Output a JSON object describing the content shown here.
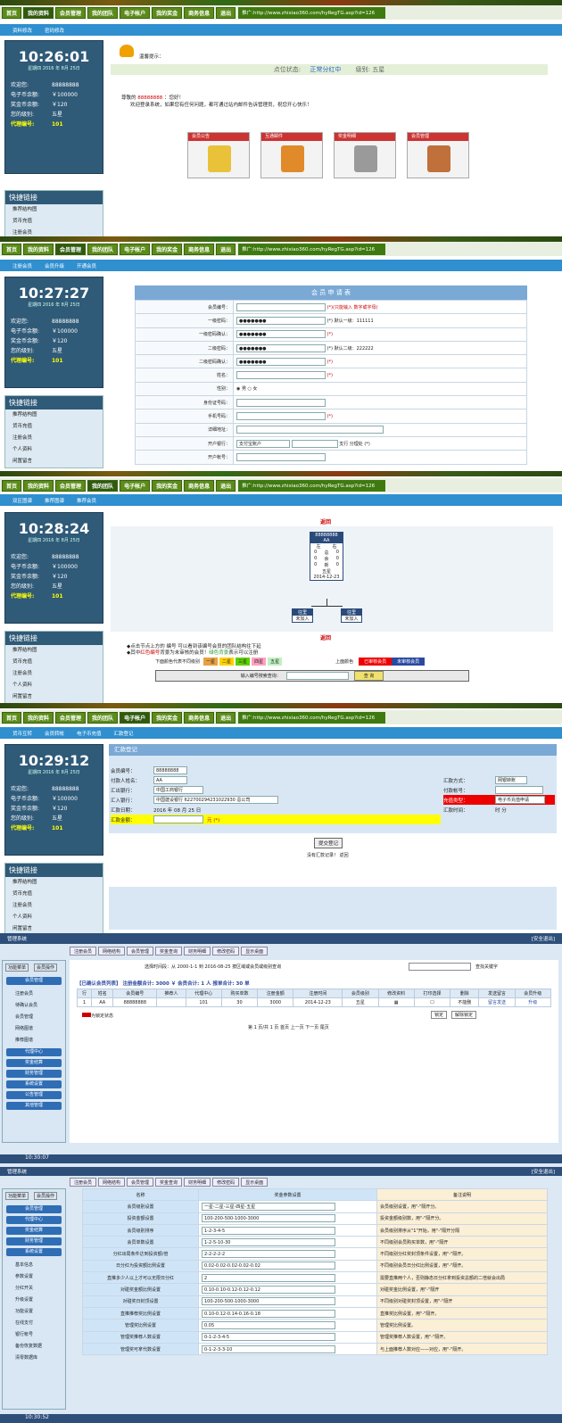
{
  "nav": {
    "items": [
      "首页",
      "我的资料",
      "会员管理",
      "我的团队",
      "电子帐户",
      "我的奖金",
      "商务信息",
      "退出"
    ],
    "url": "推广:http://www.zhixiao360.com/hyRegTG.asp?id=126"
  },
  "side": {
    "date": "星期四 2016 年 8月 25日",
    "labels": [
      "欢迎您:",
      "电子币余额:",
      "奖金币余额:",
      "您的级别:",
      "代理编号:"
    ],
    "values": [
      "88888888",
      "￥100000",
      "￥120",
      "五星",
      "101"
    ],
    "quick_title": "快捷链接",
    "quick_items": [
      "推荐结构图",
      "货币充值",
      "注册会员",
      "个人资料",
      "闲置留言"
    ]
  },
  "p1": {
    "time": "10:26:01",
    "sub": [
      "资料修改",
      "密码修改"
    ],
    "tip": "温馨提示：",
    "status_label": "点位状态:",
    "status_value": "正常分红中",
    "level_label": "级别:",
    "level_value": "五星",
    "greet_prefix": "尊敬的",
    "greet_user": "88888888",
    "greet_suffix": "：您好！",
    "greet_line": "欢迎登录系统，如果您有任何问题，都可通过站内邮件告诉管理员，祝您开心快乐！",
    "buttons": [
      "会员公告",
      "互通邮件",
      "奖金明细",
      "会员管理"
    ]
  },
  "p2": {
    "time": "10:27:27",
    "sub": [
      "注册会员",
      "会员升级",
      "开通会员"
    ],
    "title": "会 员 申 请 表",
    "rows": [
      {
        "label": "会员编号：",
        "hint": "(*)(只能输入 数字或字母)"
      },
      {
        "label": "一级密码：",
        "value": "●●●●●●●",
        "hint": "(*) 默认一级：111111"
      },
      {
        "label": "一级密码确认：",
        "value": "●●●●●●●",
        "hint": "(*)"
      },
      {
        "label": "二级密码：",
        "value": "●●●●●●●",
        "hint": "(*) 默认二级：222222"
      },
      {
        "label": "二级密码确认：",
        "value": "●●●●●●●",
        "hint": "(*)"
      },
      {
        "label": "姓名：",
        "hint": "(*)"
      },
      {
        "label": "性别：",
        "value": "◉ 男 ○ 女",
        "hint": ""
      },
      {
        "label": "身份证号码：",
        "hint": ""
      },
      {
        "label": "手机号码：",
        "hint": "(*)"
      },
      {
        "label": "详细地址：",
        "hint": ""
      },
      {
        "label": "开户银行：",
        "value": "支付宝账户",
        "hint": "支行 分理处 (*)"
      },
      {
        "label": "开户帐号：",
        "hint": ""
      }
    ]
  },
  "p3": {
    "time": "10:28:24",
    "sub": [
      "双区图谱",
      "推荐图谱",
      "推荐会员"
    ],
    "back": "返回",
    "node": {
      "id": "88888888",
      "name": "AA",
      "cols": [
        "左",
        "右"
      ],
      "rows": [
        [
          "0",
          "总",
          "0"
        ],
        [
          "0",
          "余",
          "0"
        ],
        [
          "0",
          "新",
          "0"
        ]
      ],
      "level": "五星",
      "date": "2014-12-23"
    },
    "child": "往里",
    "child2": "未加入",
    "note1": "◆点击节点上方的 编号 可以看到该编号会员的团队结构往下延",
    "note2_a": "◆其中",
    "note2_b": "红色编号",
    "note2_c": "背景为未审核的会员！",
    "note2_d": "绿色背景",
    "note2_e": "表示可以注册",
    "legend_label": "下面颜色代表不同级别",
    "legend": [
      "一星",
      "二星",
      "三星",
      "四星",
      "五星"
    ],
    "colors_label": "上面颜色",
    "colors": [
      "已审核会员",
      "未审核会员"
    ],
    "search_label": "输入编号搜索查询：",
    "search_btn": "查 询"
  },
  "p4": {
    "time": "10:29:12",
    "sub": [
      "货币互转",
      "会员转帐",
      "电子币充值",
      "汇款登记"
    ],
    "title": "汇款登记",
    "left": [
      [
        "会员编号：",
        "88888888"
      ],
      [
        "付款人姓名：",
        "AA"
      ],
      [
        "汇出银行：",
        "中国工商银行"
      ],
      [
        "汇入银行：",
        "中国建设银行 622700294231022930 总公司"
      ],
      [
        "汇款日期：",
        "2016 年 08 月 25 日"
      ],
      [
        "汇款金额：",
        "元 (*)"
      ]
    ],
    "right": [
      [
        "汇款方式：",
        "网银转账"
      ],
      [
        "付款帐号：",
        ""
      ],
      [
        "充值类型：",
        "电子币充值申请"
      ],
      [
        "汇款时间：",
        "时 分"
      ]
    ],
    "submit": "提交登记",
    "none": "没有汇款记录！ 返回"
  },
  "p5": {
    "title": "管理系统",
    "logout": "[安全退出]",
    "tools": [
      "注册会员",
      "网络结构",
      "会员管理",
      "奖金查询",
      "财务明细",
      "修改密码",
      "显示桌面"
    ],
    "tabs": [
      "功能菜单",
      "会员操作"
    ],
    "menu": [
      "会员管理",
      "注册会员",
      "待确认会员",
      "会员管理",
      "网络图谱",
      "推荐图谱",
      "代理中心",
      "奖金结算",
      "财务管理",
      "系统设置",
      "公告管理",
      "其他管理"
    ],
    "filter": "选择时间段：从 2000-1-1 到 2016-08-25 按区域或会员或级别查询",
    "search": "查找关键字",
    "summary": "【已确认会员列表】 注册金额合计: 3000 ￥ 会员合计: 1 人 报单合计: 30 单",
    "headers": [
      "行",
      "姓名",
      "会员编号",
      "推荐人",
      "代理中心",
      "购买单数",
      "注册金额",
      "注册时间",
      "会员级别",
      "修改资料",
      "打印选择",
      "删除",
      "发送留言",
      "会员升级"
    ],
    "row": [
      "1",
      "AA",
      "88888888",
      "",
      "101",
      "30",
      "3000",
      "2014-12-23",
      "五星",
      "",
      "",
      "不能删",
      "留言发送",
      "升级"
    ],
    "locked": "为锁定状态",
    "lock": "锁定",
    "unlock": "解除锁定",
    "pager": "第 1 页/共 1 页 首页 上一页 下一页 尾页",
    "clock": "10:30:07"
  },
  "p6": {
    "title": "管理系统",
    "logout": "[安全退出]",
    "menu": [
      "会员管理",
      "代理中心",
      "奖金结算",
      "财务管理",
      "系统设置"
    ],
    "submenu": [
      "基本信息",
      "参数设置",
      "分红开关",
      "升级设置",
      "功能设置",
      "在线支付",
      "银行帐号",
      "备份恢复数据",
      "清零数据库"
    ],
    "headers": [
      "名称",
      "奖金参数设置",
      "备注说明"
    ],
    "rows": [
      [
        "会员级别设置",
        "一星-二星-三星-四星-五星",
        "会员级别设置，用\"-\"隔开分。"
      ],
      [
        "投资金额设置",
        "100-200-500-1000-3000",
        "投资金额级别数，用\"-\"隔开分。"
      ],
      [
        "会员级别排序",
        "1-2-3-4-5",
        "会员级别排序从\"1\"开始，用\"-\"隔开分隔"
      ],
      [
        "会员单数设置",
        "1-2-5-10-30",
        "不同级别会员购买单数，用\"-\"隔开"
      ],
      [
        "分红出局条件达到投资额/倍",
        "2-2-2-2-2",
        "不同级别分红奖封顶条件设置，用\"-\"隔开。"
      ],
      [
        "日分红为投资额比例设置",
        "0.02-0.02-0.02-0.02-0.02",
        "不同级别会员日分红比例设置，用\"-\"隔开。"
      ],
      [
        "直推多少人以上才可以无限日分红",
        "2",
        "需要直推两个人，否则静态日分红拿到投资总额的二倍就会出局"
      ],
      [
        "对碰奖金额比例设置",
        "0.10-0.10-0.12-0.12-0.12",
        "对碰奖金比例设置，用\"-\"隔开"
      ],
      [
        "对碰奖日封顶设置",
        "100-200-500-1000-3000",
        "不同级别对碰奖封顶设置，用\"-\"隔开"
      ],
      [
        "直推推荐奖比例设置",
        "0.10-0.12-0.14-0.16-0.18",
        "直推奖比例设置，用\"-\"隔开。"
      ],
      [
        "管理奖比例设置",
        "0.05",
        "管理奖比例设置。"
      ],
      [
        "管理奖推荐人数设置",
        "0-1-2-3-4-5",
        "管理奖推荐人数设置，用\"-\"隔开。"
      ],
      [
        "管理奖可拿代数设置",
        "0-1-2-3-3-10",
        "与上面推荐人数对应——对应，用\"-\"隔开。"
      ]
    ],
    "clock": "10:30:52"
  }
}
